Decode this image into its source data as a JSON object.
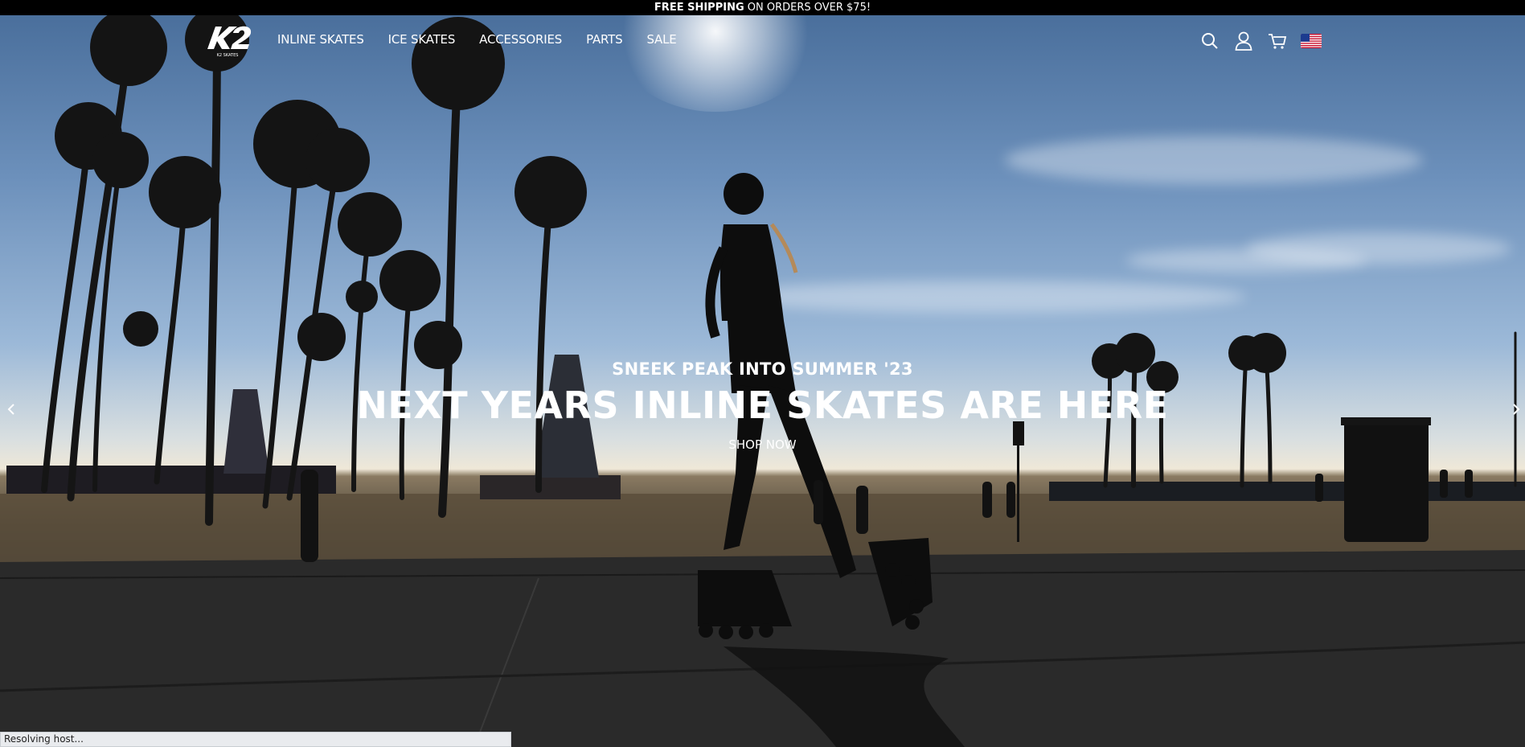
{
  "announcement": {
    "bold": "FREE SHIPPING",
    "rest": " ON ORDERS OVER $75!"
  },
  "nav": {
    "logo_text": "K2 SKATES",
    "links": [
      "INLINE SKATES",
      "ICE SKATES",
      "ACCESSORIES",
      "PARTS",
      "SALE"
    ],
    "icons": [
      "search-icon",
      "account-icon",
      "cart-icon",
      "us-flag-icon"
    ]
  },
  "hero": {
    "eyebrow": "SNEEK PEAK INTO SUMMER '23",
    "headline": "NEXT YEARS INLINE SKATES ARE HERE",
    "cta": "SHOP NOW"
  },
  "status_bar": {
    "text": "Resolving host..."
  },
  "colors": {
    "announcement_bg": "#000000",
    "text": "#ffffff",
    "status_bg": "#e9ebee"
  }
}
